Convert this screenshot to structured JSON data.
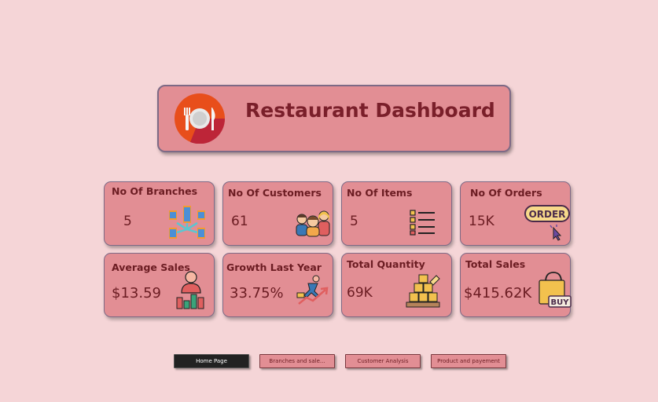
{
  "header": {
    "title": "Restaurant Dashboard",
    "logo_icon": "plate-cutlery-icon"
  },
  "cards": [
    {
      "label": "No Of Branches",
      "value": "5",
      "icon": "buildings-network-icon"
    },
    {
      "label": "No Of Customers",
      "value": "61",
      "icon": "people-group-icon"
    },
    {
      "label": "No Of Items",
      "value": "5",
      "icon": "list-icon"
    },
    {
      "label": "No Of Orders",
      "value": "15K",
      "icon": "order-click-icon",
      "icon_text": "ORDER"
    },
    {
      "label": "Average Sales",
      "value": "$13.59",
      "icon": "person-bar-chart-icon"
    },
    {
      "label": "Growth Last Year",
      "value": "33.75%",
      "icon": "growth-runner-icon"
    },
    {
      "label": "Total Quantity",
      "value": "69K",
      "icon": "boxes-pallet-icon"
    },
    {
      "label": "Total Sales",
      "value": "$415.62K",
      "icon": "shopping-bag-icon",
      "icon_text": "BUY"
    }
  ],
  "nav": [
    {
      "label": "Home Page",
      "active": true
    },
    {
      "label": "Branches and sale...",
      "active": false
    },
    {
      "label": "Customer Analysis",
      "active": false
    },
    {
      "label": "Product and payement",
      "active": false
    }
  ],
  "colors": {
    "background": "#f5d5d7",
    "card": "#e28e94",
    "text": "#6b1c22",
    "accent": "#e84e1b"
  }
}
